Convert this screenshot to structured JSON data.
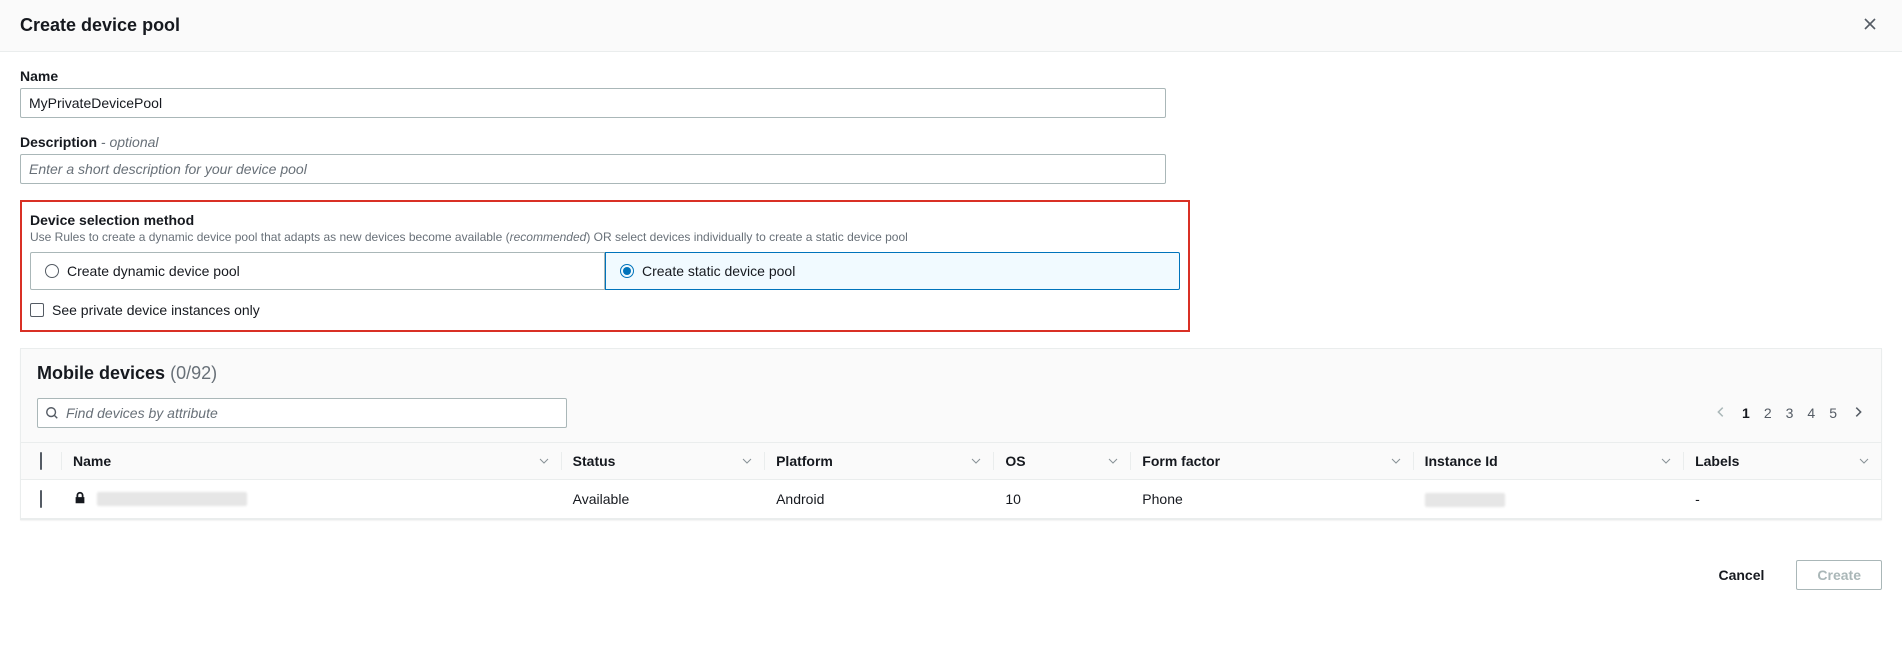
{
  "header": {
    "title": "Create device pool"
  },
  "form": {
    "name_label": "Name",
    "name_value": "MyPrivateDevicePool",
    "description_label": "Description",
    "description_optional": " - optional",
    "description_placeholder": "Enter a short description for your device pool",
    "device_selection_label": "Device selection method",
    "device_selection_hint_1": "Use Rules to create a dynamic device pool that adapts as new devices become available (",
    "device_selection_hint_em": "recommended",
    "device_selection_hint_2": ") OR select devices individually to create a static device pool",
    "radio_dynamic": "Create dynamic device pool",
    "radio_static": "Create static device pool",
    "private_only_label": "See private device instances only"
  },
  "table": {
    "title": "Mobile devices",
    "count": "(0/92)",
    "search_placeholder": "Find devices by attribute",
    "pagination": {
      "pages": [
        "1",
        "2",
        "3",
        "4",
        "5"
      ],
      "active": "1"
    },
    "columns": {
      "name": "Name",
      "status": "Status",
      "platform": "Platform",
      "os": "OS",
      "form_factor": "Form factor",
      "instance_id": "Instance Id",
      "labels": "Labels"
    },
    "rows": [
      {
        "name_redacted": true,
        "status": "Available",
        "platform": "Android",
        "os": "10",
        "form_factor": "Phone",
        "instance_id_redacted": true,
        "labels": "-"
      }
    ]
  },
  "footer": {
    "cancel": "Cancel",
    "create": "Create"
  }
}
